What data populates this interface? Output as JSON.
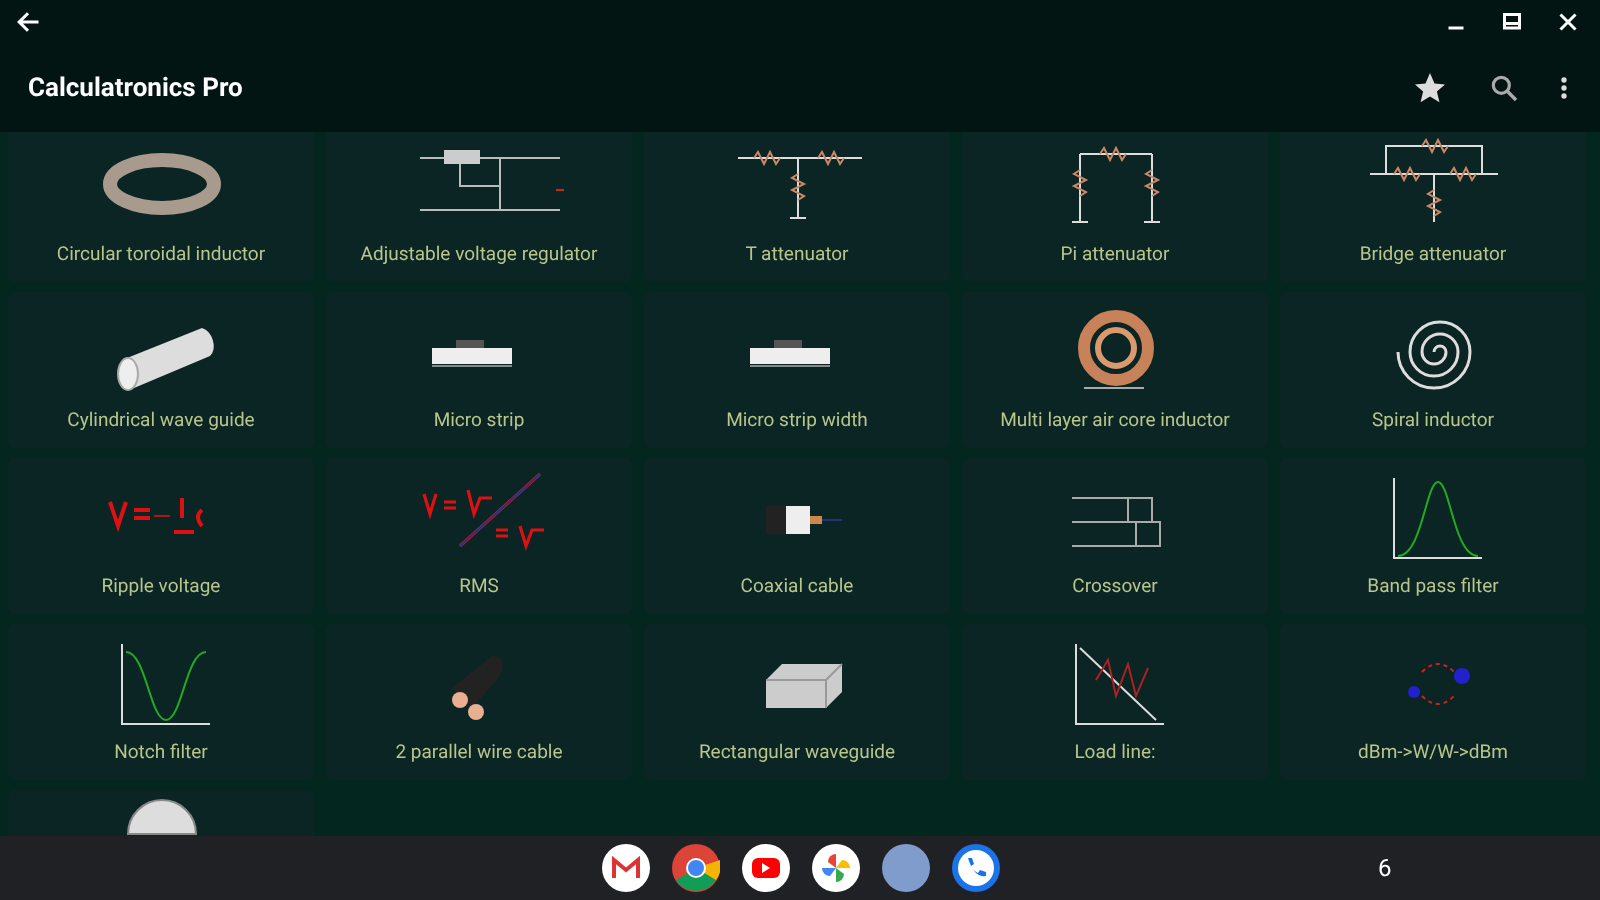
{
  "app_bar": {
    "title": "Calculatronics Pro"
  },
  "tiles": [
    {
      "label": "Circular toroidal inductor",
      "kind": "toroid"
    },
    {
      "label": "Adjustable voltage regulator",
      "kind": "regulator"
    },
    {
      "label": "T attenuator",
      "kind": "t_att"
    },
    {
      "label": "Pi attenuator",
      "kind": "pi_att"
    },
    {
      "label": "Bridge attenuator",
      "kind": "bridge_att"
    },
    {
      "label": "Cylindrical wave guide",
      "kind": "cylinder"
    },
    {
      "label": "Micro strip",
      "kind": "strip"
    },
    {
      "label": "Micro strip width",
      "kind": "strip"
    },
    {
      "label": "Multi layer air core inductor",
      "kind": "coil"
    },
    {
      "label": "Spiral inductor",
      "kind": "spiral"
    },
    {
      "label": "Ripple voltage",
      "kind": "formula"
    },
    {
      "label": "RMS",
      "kind": "formula2"
    },
    {
      "label": "Coaxial cable",
      "kind": "coax"
    },
    {
      "label": "Crossover",
      "kind": "crossover"
    },
    {
      "label": "Band pass filter",
      "kind": "bandpass"
    },
    {
      "label": "Notch filter",
      "kind": "notch"
    },
    {
      "label": "2 parallel wire cable",
      "kind": "twinwire"
    },
    {
      "label": "Rectangular waveguide",
      "kind": "box"
    },
    {
      "label": "Load line:",
      "kind": "loadline"
    },
    {
      "label": "dBm->W/W->dBm",
      "kind": "convert"
    },
    {
      "kind": "dial"
    }
  ],
  "taskbar": {
    "apps": [
      {
        "kind": "mail"
      },
      {
        "kind": "browser"
      },
      {
        "kind": "video"
      },
      {
        "kind": "photos"
      },
      {
        "kind": "blank"
      },
      {
        "kind": "phone"
      }
    ],
    "status": "6"
  }
}
